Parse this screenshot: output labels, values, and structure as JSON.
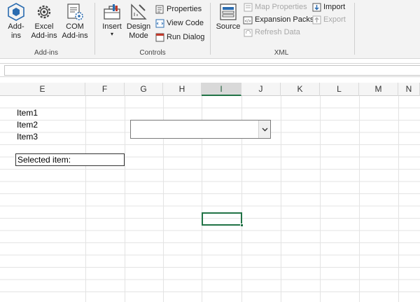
{
  "ribbon": {
    "addins": {
      "group_label": "Add-ins",
      "buttons": [
        {
          "label": "Add-\nins",
          "icon": "addins-hexagon-icon"
        },
        {
          "label": "Excel\nAdd-ins",
          "icon": "gear-icon"
        },
        {
          "label": "COM\nAdd-ins",
          "icon": "com-addins-icon"
        }
      ]
    },
    "controls": {
      "group_label": "Controls",
      "insert_label": "Insert",
      "design_mode_label": "Design\nMode",
      "properties_label": "Properties",
      "view_code_label": "View Code",
      "run_dialog_label": "Run Dialog"
    },
    "xml": {
      "group_label": "XML",
      "source_label": "Source",
      "map_properties_label": "Map Properties",
      "expansion_packs_label": "Expansion Packs",
      "refresh_data_label": "Refresh Data",
      "import_label": "Import",
      "export_label": "Export"
    }
  },
  "grid": {
    "columns": [
      "E",
      "F",
      "G",
      "H",
      "I",
      "J",
      "K",
      "L",
      "M",
      "N"
    ],
    "selected_column": "I",
    "cells": {
      "item1": "Item1",
      "item2": "Item2",
      "item3": "Item3",
      "selected_item": "Selected item:"
    },
    "combo_value": ""
  },
  "colors": {
    "accent": "#217346",
    "ribbon_bg": "#f3f3f3",
    "gridline": "#e3e3e3"
  }
}
